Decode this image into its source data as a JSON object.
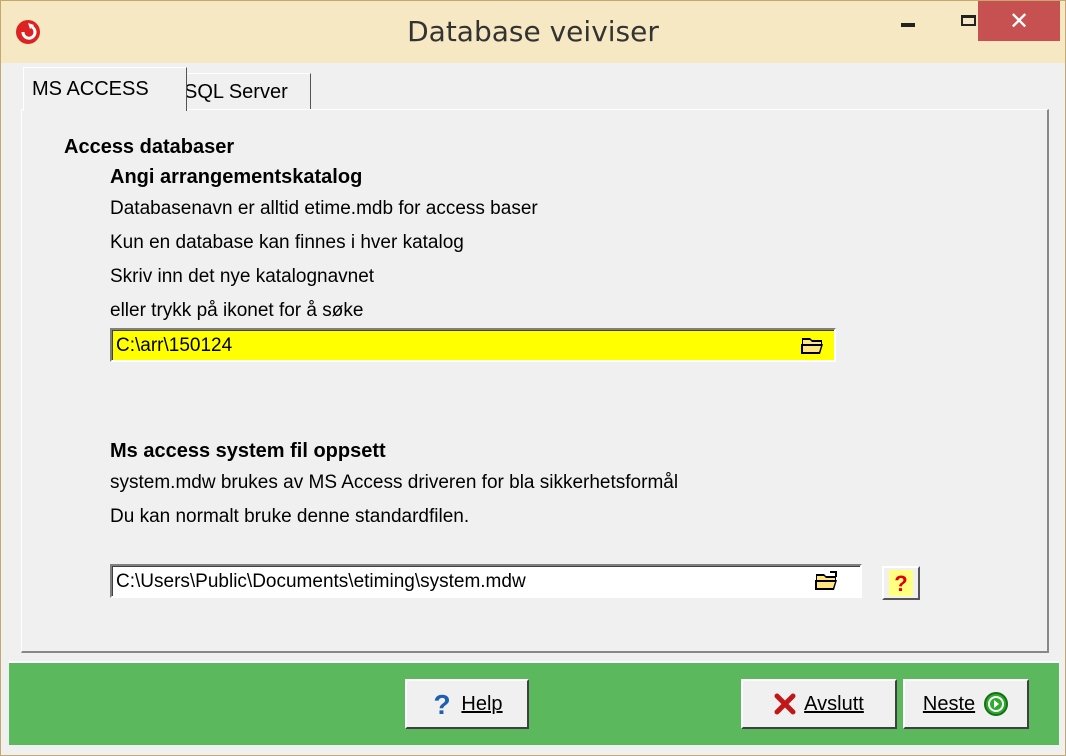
{
  "window": {
    "title": "Database veiviser"
  },
  "tabs": [
    {
      "label": "MS ACCESS"
    },
    {
      "label": "SQL Server"
    }
  ],
  "access": {
    "heading": "Access databaser",
    "catalog": {
      "heading": "Angi arrangementskatalog",
      "lines": [
        "Databasenavn er alltid etime.mdb for access baser",
        "Kun en database kan finnes i hver katalog",
        "Skriv inn det nye katalognavnet",
        "eller trykk på ikonet for å søke"
      ],
      "path_value": "C:\\arr\\150124"
    },
    "system": {
      "heading": "Ms access system fil oppsett",
      "lines": [
        "system.mdw brukes av MS Access driveren for bla sikkerhetsformål",
        "Du kan normalt bruke denne standardfilen."
      ],
      "path_value": "C:\\Users\\Public\\Documents\\etiming\\system.mdw"
    }
  },
  "footer": {
    "help_label": "Help",
    "cancel_label": "Avslutt",
    "next_label": "Neste"
  },
  "colors": {
    "titlebar": "#f5e8c2",
    "close": "#c75050",
    "footer": "#5cb85c",
    "highlight_field": "#ffff00"
  }
}
